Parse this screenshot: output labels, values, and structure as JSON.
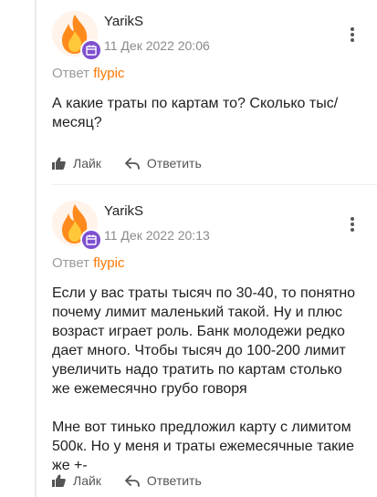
{
  "comments": [
    {
      "username": "YarikS",
      "date": "11 Дек 2022 20:06",
      "reply_prefix": "Ответ",
      "reply_to": "flypic",
      "text": "А какие траты по картам то? Сколько тыс/\nмесяц?",
      "like_label": "Лайк",
      "reply_label": "Ответить"
    },
    {
      "username": "YarikS",
      "date": "11 Дек 2022 20:13",
      "reply_prefix": "Ответ",
      "reply_to": "flypic",
      "text": "Если у вас траты тысяч по 30-40, то понятно\nпочему лимит маленький такой. Ну и плюс\nвозраст играет роль. Банк молодежи редко\nдает много. Чтобы тысяч до 100-200 лимит\nувеличить надо тратить по картам столько\nже ежемесячно грубо говоря\n\nМне вот тинько предложил карту с лимитом\n500к. Но у меня и траты ежемесячные такие\nже +-",
      "like_label": "Лайк",
      "reply_label": "Ответить"
    }
  ],
  "colors": {
    "accent": "#ff7700",
    "badge": "#7e4fd0",
    "meta": "#8a8a8a"
  },
  "icons": {
    "avatar": "flame-avatar-icon",
    "badge": "calendar-badge-icon",
    "like": "thumbs-up-icon",
    "reply": "reply-arrow-icon",
    "more": "more-vertical-icon"
  }
}
